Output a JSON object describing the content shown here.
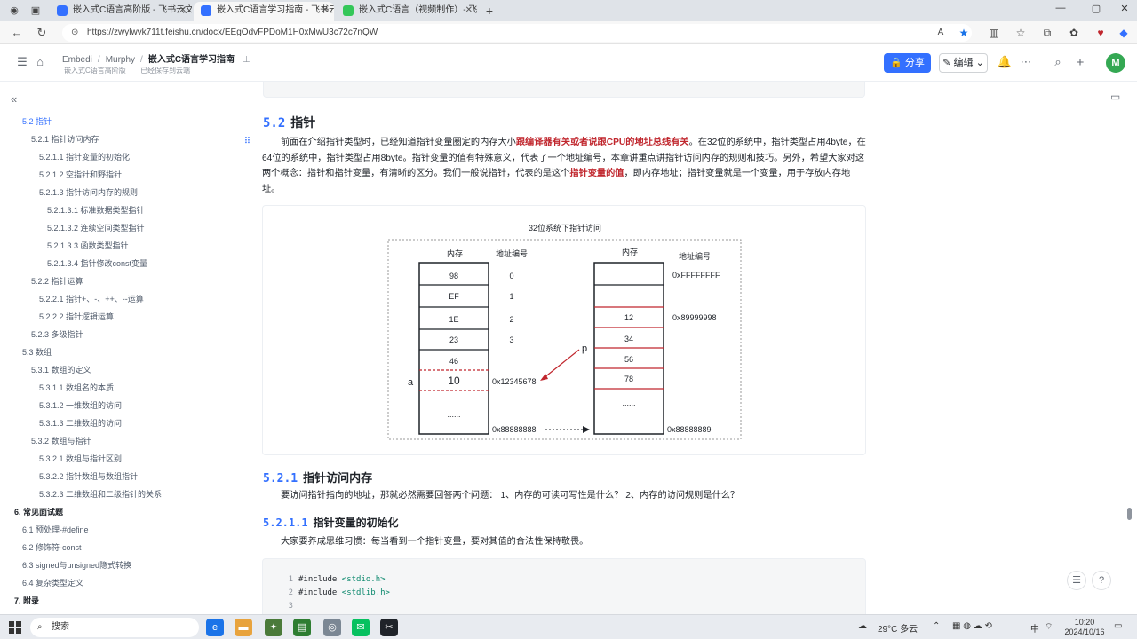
{
  "browser": {
    "tabs": [
      {
        "title": "嵌入式C语言高阶版 - 飞书云文档",
        "color": "#3370ff"
      },
      {
        "title": "嵌入式C语言学习指南 - 飞书云文",
        "color": "#3370ff"
      },
      {
        "title": "嵌入式C语言（视频制作）- 飞书",
        "color": "#34c759"
      }
    ],
    "new_tab": "+",
    "url": "https://zwylwvk711t.feishu.cn/docx/EEgOdvFPDoM1H0xMwU3c72c7nQW"
  },
  "doc_header": {
    "breadcrumbs": [
      "Embedi",
      "Murphy",
      "嵌入式C语言学习指南"
    ],
    "sub_left": "嵌入式C语言高阶版",
    "sub_right": "已经保存到云端",
    "share_label": "分享",
    "edit_label": "编辑",
    "avatar_letter": "M",
    "accent": "#3370ff"
  },
  "toc": [
    {
      "label": "5.2 指针",
      "level": 1,
      "active": true
    },
    {
      "label": "5.2.1 指针访问内存",
      "level": 2
    },
    {
      "label": "5.2.1.1 指针变量的初始化",
      "level": 3
    },
    {
      "label": "5.2.1.2 空指针和野指针",
      "level": 3
    },
    {
      "label": "5.2.1.3 指针访问内存的规则",
      "level": 3
    },
    {
      "label": "5.2.1.3.1 标准数据类型指针",
      "level": 4
    },
    {
      "label": "5.2.1.3.2 连续空间类型指针",
      "level": 4
    },
    {
      "label": "5.2.1.3.3 函数类型指针",
      "level": 4
    },
    {
      "label": "5.2.1.3.4 指针修改const变量",
      "level": 4
    },
    {
      "label": "5.2.2 指针运算",
      "level": 2
    },
    {
      "label": "5.2.2.1 指针+、-、++、--运算",
      "level": 3
    },
    {
      "label": "5.2.2.2 指针逻辑运算",
      "level": 3
    },
    {
      "label": "5.2.3 多级指针",
      "level": 2
    },
    {
      "label": "5.3 数组",
      "level": 1
    },
    {
      "label": "5.3.1 数组的定义",
      "level": 2
    },
    {
      "label": "5.3.1.1 数组名的本质",
      "level": 3
    },
    {
      "label": "5.3.1.2 一维数组的访问",
      "level": 3
    },
    {
      "label": "5.3.1.3 二维数组的访问",
      "level": 3
    },
    {
      "label": "5.3.2 数组与指针",
      "level": 2
    },
    {
      "label": "5.3.2.1 数组与指针区别",
      "level": 3
    },
    {
      "label": "5.3.2.2 指针数组与数组指针",
      "level": 3
    },
    {
      "label": "5.3.2.3 二维数组和二级指针的关系",
      "level": 3
    },
    {
      "label": "6. 常见面试题",
      "level": 0
    },
    {
      "label": "6.1 预处理-#define",
      "level": 1
    },
    {
      "label": "6.2 修饰符-const",
      "level": 1
    },
    {
      "label": "6.3 signed与unsigned隐式转换",
      "level": 1
    },
    {
      "label": "6.4 复杂类型定义",
      "level": 1
    },
    {
      "label": "7. 附录",
      "level": 0
    }
  ],
  "content": {
    "h2": {
      "num": "5.2",
      "text": "指针"
    },
    "intro": {
      "p1a": "前面在介绍指针类型时，已经知道指针变量圈定的内存大小",
      "p1b": "跟编译器有关或者说跟CPU的地址总线有关",
      "p1c": "。在32位的系统中，指针类型占用4byte，在64位的系统中，指针类型占用8byte。指针变量的值有特殊意义，代表了一个地址编号，本章讲重点讲指针访问内存的规则和技巧。另外，希望大家对这两个概念：指针和指针变量，有清晰的区分。我们一般说指针，代表的是这个",
      "p1d": "指针变量的值",
      "p1e": "，即内存地址；指针变量就是一个变量，用于存放内存地址。"
    },
    "figure": {
      "title": "32位系统下指针访问",
      "left_mem_label": "内存",
      "left_addr_label": "地址编号",
      "left_cells": [
        "98",
        "EF",
        "1E",
        "23",
        "46",
        "10",
        "......"
      ],
      "left_addrs": [
        "0",
        "1",
        "2",
        "3",
        "......",
        "0x12345678",
        "......",
        "0x88888888"
      ],
      "var_a": "a",
      "pointer_p": "p",
      "right_mem_label": "内存",
      "right_addr_label": "地址编号",
      "right_cells": [
        "",
        "",
        "12",
        "34",
        "56",
        "78",
        "......"
      ],
      "right_addrs": [
        "0xFFFFFFFF",
        "0x89999998",
        "0x88888889"
      ],
      "red": "#c0262d"
    },
    "h3": {
      "num": "5.2.1",
      "text": "指针访问内存"
    },
    "p2": "要访问指针指向的地址，那就必然需要回答两个问题： 1、内存的可读可写性是什么？ 2、内存的访问规则是什么？",
    "h4": {
      "num": "5.2.1.1",
      "text": "指针变量的初始化"
    },
    "p3": "大家要养成思维习惯：每当看到一个指针变量，要对其值的合法性保持敬畏。",
    "code": [
      {
        "ln": "1",
        "kw": "#include",
        "arg": "<stdio.h>"
      },
      {
        "ln": "2",
        "kw": "#include",
        "arg": "<stdlib.h>"
      },
      {
        "ln": "3",
        "kw": "",
        "arg": ""
      }
    ]
  },
  "taskbar": {
    "search_label": "搜索",
    "weather": "29°C 多云",
    "ime": "中",
    "time": "10:20",
    "date": "2024/10/16"
  }
}
